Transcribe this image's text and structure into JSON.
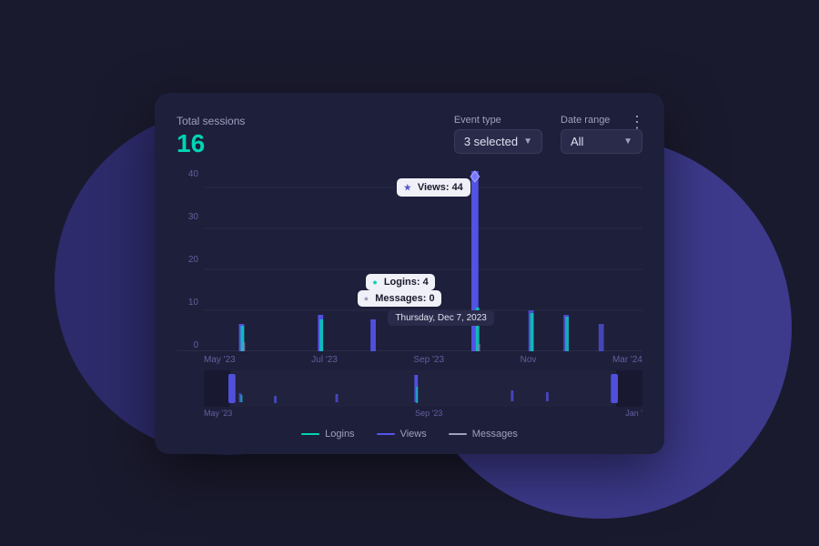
{
  "background": {
    "color": "#1a1a2e"
  },
  "card": {
    "total_sessions_label": "Total sessions",
    "total_sessions_value": "16",
    "event_type_label": "Event type",
    "event_type_value": "3 selected",
    "date_range_label": "Date range",
    "date_range_value": "All",
    "more_options_icon": "⋮"
  },
  "chart": {
    "y_labels": [
      "0",
      "10",
      "20",
      "30",
      "40"
    ],
    "x_labels": [
      "May '23",
      "Jul '23",
      "Sep '23",
      "Nov",
      "Mar '24"
    ],
    "tooltip_views_label": "Views: 44",
    "tooltip_logins_label": "Logins: 4",
    "tooltip_messages_label": "Messages: 0",
    "tooltip_date": "Thursday, Dec 7, 2023"
  },
  "minimap": {
    "x_labels": [
      "May '23",
      "Sep '23",
      "Jan '"
    ]
  },
  "legend": {
    "items": [
      {
        "label": "Logins",
        "color": "#00d4b4"
      },
      {
        "label": "Views",
        "color": "#5555ee"
      },
      {
        "label": "Messages",
        "color": "#a0a0c0"
      }
    ]
  }
}
